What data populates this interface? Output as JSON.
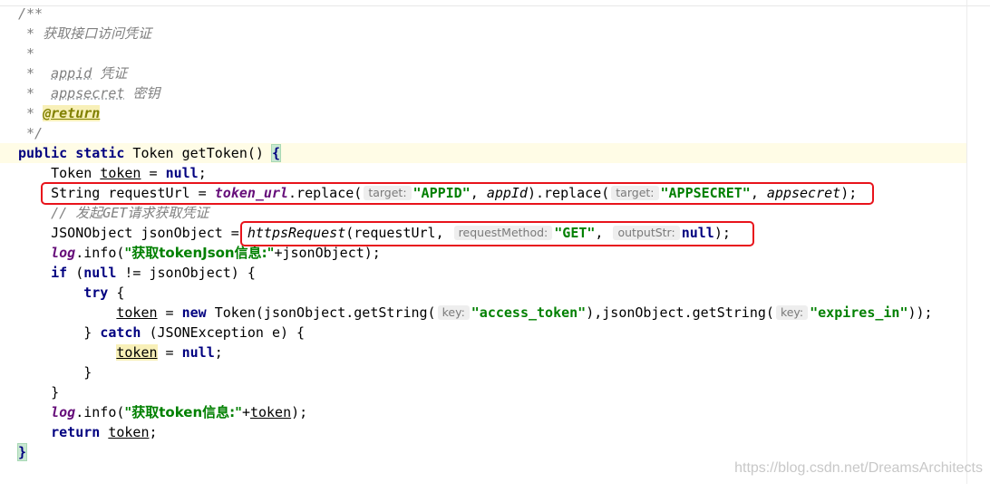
{
  "code": {
    "doc_open": "/**",
    "doc_title": " * 获取接口访问凭证",
    "doc_blank": " *",
    "doc_param1_prefix": " *  ",
    "doc_param1_name": "appid",
    "doc_param1_desc": " 凭证",
    "doc_param2_prefix": " *  ",
    "doc_param2_name": "appsecret",
    "doc_param2_desc": " 密钥",
    "doc_return_prefix": " * ",
    "doc_return_tag": "@return",
    "doc_close": " */",
    "sig_kw": "public static",
    "sig_rest": " Token getToken() ",
    "sig_brace": "{",
    "l1_type": "    Token ",
    "l1_var": "token",
    "l1_eq": " = ",
    "l1_null": "null",
    "l1_end": ";",
    "l2_a": "    String requestUrl = ",
    "l2_field": "token_url",
    "l2_b": ".replace(",
    "l2_hint1": "target:",
    "l2_s1": "\"APPID\"",
    "l2_c": ", ",
    "l2_p1": "appId",
    "l2_d": ").replace(",
    "l2_hint2": "target:",
    "l2_s2": "\"APPSECRET\"",
    "l2_e": ", ",
    "l2_p2": "appsecret",
    "l2_f": ");",
    "l3_comment_a": "    // 发起",
    "l3_comment_get": "GET",
    "l3_comment_b": "请求获取凭证",
    "l4_a": "    JSONObject jsonObject = ",
    "l4_method": "httpsRequest",
    "l4_b": "(requestUrl, ",
    "l4_hint1": "requestMethod:",
    "l4_s1": "\"GET\"",
    "l4_c": ", ",
    "l4_hint2": "outputStr:",
    "l4_null": "null",
    "l4_d": ");",
    "l5_indent": "    ",
    "l5_log": "log",
    "l5_a": ".info(",
    "l5_str": "\"获取tokenJson信息:\"",
    "l5_b": "+jsonObject);",
    "l6_indent": "    ",
    "l6_if": "if",
    "l6_a": " (",
    "l6_null": "null",
    "l6_b": " != jsonObject) {",
    "l7_indent": "        ",
    "l7_try": "try",
    "l7_a": " {",
    "l8_indent": "            ",
    "l8_var": "token",
    "l8_a": " = ",
    "l8_new": "new",
    "l8_b": " Token(jsonObject.getString(",
    "l8_hint1": "key:",
    "l8_s1": "\"access_token\"",
    "l8_c": "),jsonObject.getString(",
    "l8_hint2": "key:",
    "l8_s2": "\"expires_in\"",
    "l8_d": "));",
    "l9_indent": "        ",
    "l9_a": "} ",
    "l9_catch": "catch",
    "l9_b": " (JSONException e) {",
    "l10_indent": "            ",
    "l10_var": "token",
    "l10_a": " = ",
    "l10_null": "null",
    "l10_b": ";",
    "l11": "        }",
    "l12": "    }",
    "l13_indent": "    ",
    "l13_log": "log",
    "l13_a": ".info(",
    "l13_str": "\"获取token信息:\"",
    "l13_b": "+",
    "l13_var": "token",
    "l13_c": ");",
    "l14_indent": "    ",
    "l14_return": "return",
    "l14_a": " ",
    "l14_var": "token",
    "l14_b": ";",
    "l15_brace": "}"
  },
  "watermark": "https://blog.csdn.net/DreamsArchitects",
  "colors": {
    "highlight_box": "#e8131b",
    "keyword": "#000080",
    "string": "#008000",
    "field": "#660e7a",
    "comment": "#808080"
  }
}
